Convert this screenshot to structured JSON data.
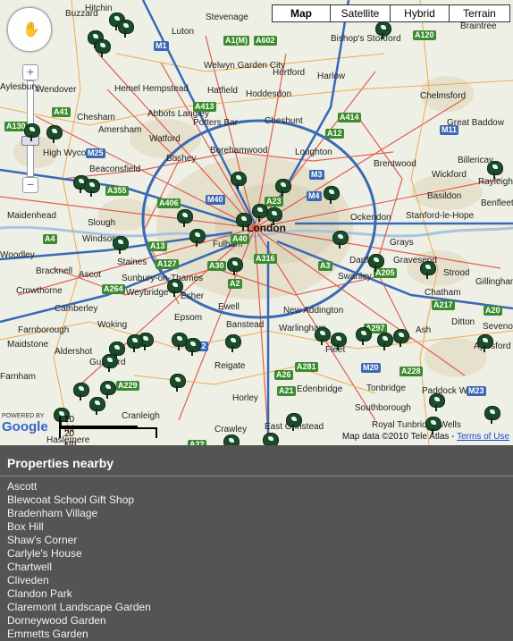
{
  "map_type_buttons": [
    {
      "label": "Map",
      "selected": true
    },
    {
      "label": "Satellite",
      "selected": false
    },
    {
      "label": "Hybrid",
      "selected": false
    },
    {
      "label": "Terrain",
      "selected": false
    }
  ],
  "controls": {
    "zoom_in": "+",
    "zoom_out": "−",
    "pan_icon": "hand-icon"
  },
  "places": [
    "Luton",
    "Stevenage",
    "Bishop's Stortford",
    "Braintree",
    "Hitchin",
    "Buzzard",
    "Aylesbury",
    "Hemel Hempstead",
    "Welwyn Garden City",
    "Hertford",
    "Harlow",
    "Wendover",
    "Abbots Langley",
    "Hatfield",
    "Hoddesdon",
    "Chelmsford",
    "Chesham",
    "Amersham",
    "Watford",
    "Potters Bar",
    "Cheshunt",
    "Great Baddow",
    "High Wycombe",
    "Bushey",
    "Borehamwood",
    "Loughton",
    "Brentwood",
    "Billericay",
    "Beaconsfield",
    "Wickford",
    "Rayleigh",
    "Basildon",
    "Benfleet",
    "Maidenhead",
    "Slough",
    "Ockendon",
    "Stanford-le-Hope",
    "Windsor",
    "Fulham",
    "Grays",
    "Woodley",
    "Staines",
    "Sunbury-on-Thames",
    "Dartford",
    "Gravesend",
    "Bracknell",
    "Ascot",
    "Weybridge",
    "Esher",
    "Swanley",
    "Strood",
    "Gillingham",
    "Crowthorne",
    "Chatham",
    "Camberley",
    "Ewell",
    "New Addington",
    "Farnborough",
    "Woking",
    "Epsom",
    "Banstead",
    "Warlingham",
    "Fleet",
    "Ash",
    "Sevenoaks",
    "Ditton",
    "Aylesford",
    "Maidstone",
    "Aldershot",
    "Guildford",
    "Reigate",
    "Edenbridge",
    "Tonbridge",
    "Paddock Wood",
    "Farnham",
    "Horley",
    "Southborough",
    "Cranleigh",
    "Crawley",
    "East Grinstead",
    "Royal Tunbridge Wells",
    "Haslemere"
  ],
  "city_label": "London",
  "roads": [
    "M1",
    "A1(M)",
    "A602",
    "A120",
    "A130",
    "A41",
    "A413",
    "A414",
    "M11",
    "A12",
    "M25",
    "A355",
    "M40",
    "A406",
    "A40",
    "A4",
    "M4",
    "A13",
    "A127",
    "A30",
    "A316",
    "A3",
    "A205",
    "A20",
    "A2",
    "M2",
    "A297",
    "A217",
    "M20",
    "A228",
    "A21",
    "A26",
    "M23",
    "A22",
    "A229",
    "A264",
    "A281",
    "M3",
    "A23"
  ],
  "scale": {
    "miles": "10 mi",
    "km": "20 km"
  },
  "logo_text": "Google",
  "logo_powered": "POWERED BY",
  "copyright_text": "Map data ©2010 Tele Atlas - ",
  "terms_link": "Terms of Use",
  "panel": {
    "title": "Properties nearby",
    "items": [
      "Ascott",
      "Blewcoat School Gift Shop",
      "Bradenham Village",
      "Box Hill",
      "Shaw's Corner",
      "Carlyle's House",
      "Chartwell",
      "Cliveden",
      "Clandon Park",
      "Claremont Landscape Garden",
      "Dorneywood Garden",
      "Emmetts Garden"
    ]
  },
  "colors": {
    "motorway": "#3a68b4",
    "a_road": "#3c8a2e",
    "urban": "#e8e3cf",
    "road_red": "#e0443a",
    "road_orange": "#f0a23a",
    "marker": "#1d4a2a",
    "panel_bg": "#545454"
  }
}
